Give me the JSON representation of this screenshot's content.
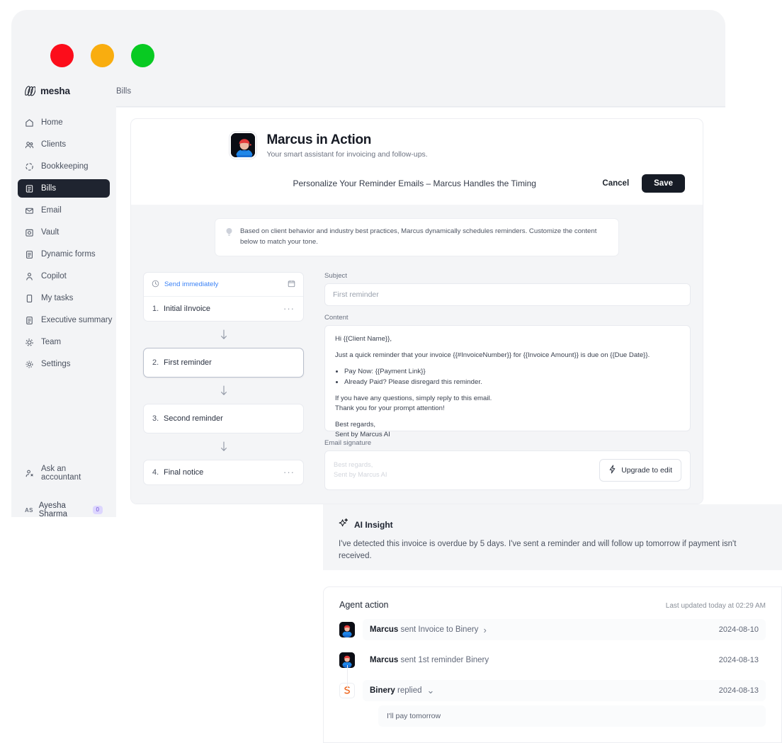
{
  "window": {
    "traffic_lights": [
      "close-red",
      "minimize-yellow",
      "maximize-green"
    ]
  },
  "sidebar": {
    "brand": "mesha",
    "items": [
      {
        "label": "Home",
        "icon": "home-icon",
        "active": false
      },
      {
        "label": "Clients",
        "icon": "users-icon",
        "active": false
      },
      {
        "label": "Bookkeeping",
        "icon": "dashed-circle-icon",
        "active": false
      },
      {
        "label": "Bills",
        "icon": "bills-icon",
        "active": true
      },
      {
        "label": "Email",
        "icon": "envelope-icon",
        "active": false
      },
      {
        "label": "Vault",
        "icon": "vault-icon",
        "active": false
      },
      {
        "label": "Dynamic forms",
        "icon": "form-icon",
        "active": false
      },
      {
        "label": "Copilot",
        "icon": "copilot-icon",
        "active": false
      },
      {
        "label": "My tasks",
        "icon": "clipboard-icon",
        "active": false
      },
      {
        "label": "Executive summary",
        "icon": "document-icon",
        "active": false
      },
      {
        "label": "Team",
        "icon": "team-icon",
        "active": false
      },
      {
        "label": "Settings",
        "icon": "gear-icon",
        "active": false
      }
    ],
    "ask_accountant": "Ask an accountant",
    "user": {
      "initials": "AS",
      "name": "Ayesha Sharma",
      "badge": "0"
    }
  },
  "topbar": {
    "tab": "Bills"
  },
  "hero": {
    "title": "Marcus in Action",
    "subtitle": "Your smart assistant for invoicing and follow-ups."
  },
  "subheader": {
    "title": "Personalize Your Reminder Emails – Marcus Handles the Timing",
    "cancel_label": "Cancel",
    "save_label": "Save"
  },
  "notice": {
    "text": "Based on client behavior and industry best practices, Marcus dynamically schedules reminders. Customize the content below to match your tone."
  },
  "steps": {
    "schedule_label": "Send immediately",
    "items": [
      {
        "num": "1.",
        "name": "Initial iInvoice",
        "menu": "···",
        "selected": false,
        "has_menu": true
      },
      {
        "num": "2.",
        "name": "First reminder",
        "menu": "",
        "selected": true,
        "has_menu": false
      },
      {
        "num": "3.",
        "name": "Second reminder",
        "menu": "",
        "selected": false,
        "has_menu": false
      },
      {
        "num": "4.",
        "name": "Final notice",
        "menu": "···",
        "selected": false,
        "has_menu": true
      }
    ]
  },
  "email_form": {
    "subject_label": "Subject",
    "subject_value": "First reminder",
    "content_label": "Content",
    "content": {
      "greeting": "Hi {{Client Name}},",
      "intro": "Just a quick reminder that your invoice {{#InvoiceNumber}} for {{Invoice Amount}} is due on {{Due Date}}.",
      "bullets": [
        "Pay Now: {{Payment Link}}",
        "Already Paid? Please disregard this reminder."
      ],
      "questions_line1": "If you have any questions, simply reply to this email.",
      "questions_line2": "Thank you for your prompt attention!",
      "signoff_line1": "Best regards,",
      "signoff_line2": "Sent by Marcus AI"
    },
    "signature_label": "Email signature",
    "signature_line1": "Best regards,",
    "signature_line2": "Sent by Marcus AI",
    "upgrade_label": "Upgrade to edit"
  },
  "ai_insight": {
    "title": "AI Insight",
    "body": "I've detected this invoice is overdue by 5 days. I've sent a reminder and will follow up tomorrow if payment isn't received."
  },
  "agent_action": {
    "title": "Agent action",
    "last_updated": "Last updated today at 02:29 AM",
    "rows": [
      {
        "actor": "Marcus",
        "text": "sent Invoice to Binery",
        "chevron": "›",
        "date": "2024-08-10",
        "avatar": "marcus-avatar",
        "highlight": true
      },
      {
        "actor": "Marcus",
        "text": "sent 1st reminder Binery",
        "chevron": "",
        "date": "2024-08-13",
        "avatar": "marcus-avatar",
        "highlight": false
      },
      {
        "actor": "Binery",
        "text": "replied",
        "chevron": "⌄",
        "date": "2024-08-13",
        "avatar": "binery-avatar",
        "highlight": true
      }
    ],
    "reply": "I'll pay tomorrow"
  },
  "colors": {
    "accent_dark": "#161b25",
    "link_blue": "#3b82f6",
    "panel_bg": "#f4f5f7",
    "sidebar_bg": "#f3f4f6",
    "badge_purple": "#ddd6fe",
    "traffic_red": "#fc0d1b",
    "traffic_yellow": "#f9ad0f",
    "traffic_green": "#08ca22"
  }
}
